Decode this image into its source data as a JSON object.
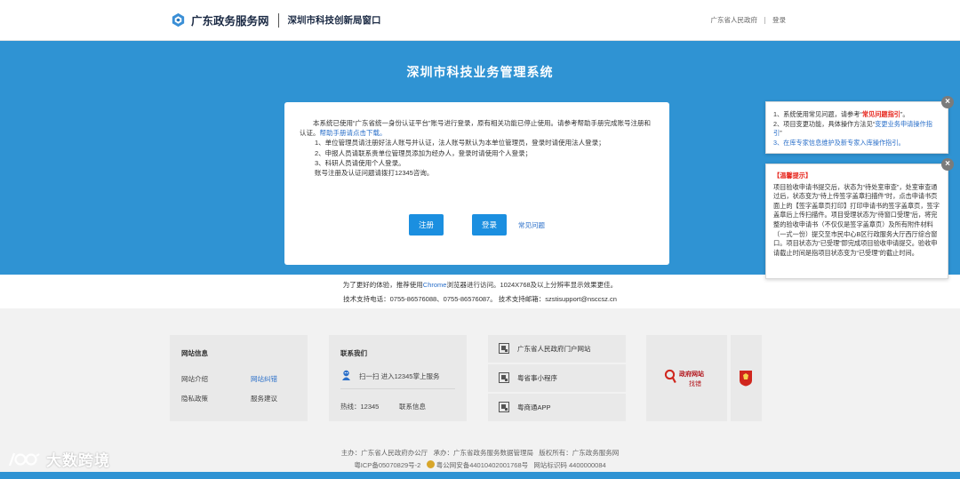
{
  "header": {
    "site_name": "广东政务服务网",
    "window_name": "深圳市科技创新局窗口",
    "link_gov": "广东省人民政府",
    "link_login": "登录"
  },
  "banner": {
    "title": "深圳市科技业务管理系统"
  },
  "notice": {
    "intro": "本系统已使用“广东省统一身份认证平台”账号进行登录，原有相关功能已停止使用。请参考帮助手册完成账号注册和认证。",
    "help_link": "帮助手册请点击下载。",
    "items": [
      "1、单位管理员请注册好法人账号并认证，法人账号默认为本单位管理员，登录时请使用法人登录；",
      "2、申报人员请联系贵单位管理员添加为经办人，登录时请使用个人登录；",
      "3、科研人员请使用个人登录。"
    ],
    "contact": "账号注册及认证问题请拨打12345咨询。",
    "register_label": "注册",
    "login_label": "登录",
    "faq_label": "常见问题"
  },
  "hints": {
    "browser_pre": "为了更好的体验，推荐使用",
    "browser_name": "Chrome",
    "browser_post": "浏览器进行访问。1024X768及以上分辨率显示效果更佳。",
    "support": "技术支持电话：0755-86576088、0755-86576087。 技术支持邮箱：szstisupport@nsccsz.cn"
  },
  "footer": {
    "site_info": {
      "heading": "网站信息",
      "links": [
        "网站介绍",
        "网站纠错",
        "隐私政策",
        "服务建议"
      ]
    },
    "contact": {
      "heading": "联系我们",
      "scan": "扫一扫 进入12345掌上服务",
      "hotline": "热线：12345",
      "info": "联系信息"
    },
    "qr_links": [
      "广东省人民政府门户网站",
      "粤省事小程序",
      "粤商通APP"
    ],
    "badge_top": "政府网站",
    "badge_bottom": "找错",
    "sponsor": "主办：广东省人民政府办公厅",
    "organizer": "承办：广东省政务服务数据管理局",
    "copyright": "版权所有：广东政务服务网",
    "icp": "粤ICP备05070829号-2",
    "police": "粤公网安备44010402001768号",
    "site_id": "网站标识码 4400000084"
  },
  "popups": {
    "tips1": {
      "line1_pre": "1、系统使用常见问题，请参考“",
      "line1_emph": "常见问题指引",
      "line1_post": "”。",
      "line2_pre": "2、项目变更功能，具体操作方法见“",
      "line2_link": "变更业务申请操作指引",
      "line2_post": "”",
      "line3": "3、在库专家信息维护及新专家入库操作指引。"
    },
    "tips2": {
      "heading": "【温馨提示】",
      "body": "项目验收申请书提交后，状态为“待处室审查”，处室审查通过后，状态变为“待上传签字盖章扫描件”时，点击申请书页面上的【签字盖章页打印】打印申请书的签字盖章页，签字盖章后上传扫描件。项目受理状态为“待窗口受理”后，将完整的验收申请书（不仅仅是签字盖章页）及所有附件材料（一式一份）提交至市民中心B区行政服务大厅西厅综合窗口。项目状态为“已受理”即完成项目验收申请提交。验收申请截止时间是指项目状态变为“已受理”的截止时间。"
    },
    "close_glyph": "×"
  },
  "watermark": "大数跨境",
  "colors": {
    "banner": "#2f93d3",
    "button": "#1b8fe0",
    "link": "#2a6fc9",
    "emphasis": "#e6231a"
  }
}
